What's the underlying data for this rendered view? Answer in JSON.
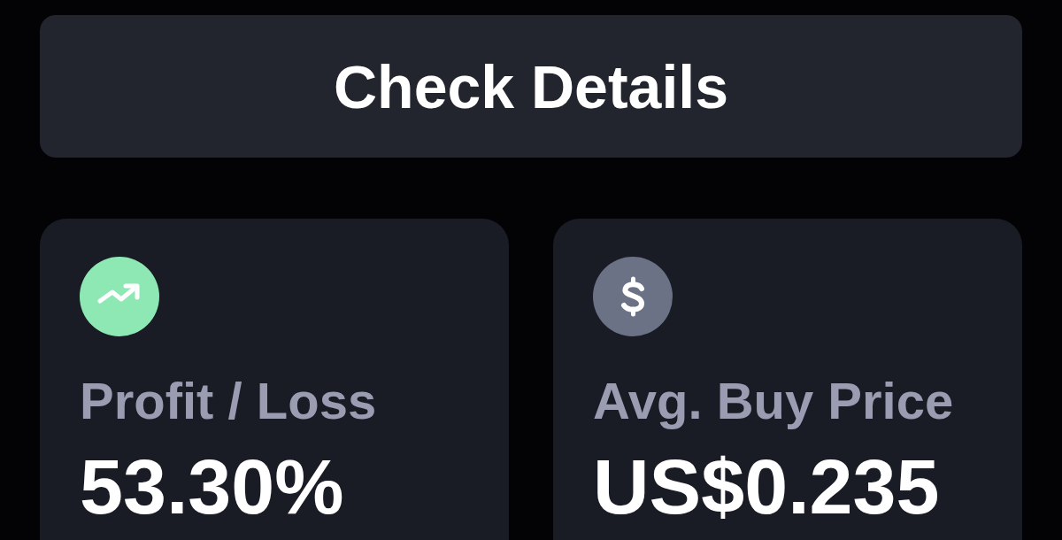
{
  "action_button": {
    "label": "Check Details"
  },
  "stat_cards": [
    {
      "kind": "trend",
      "color": "#8ee8b4",
      "label": "Profit / Loss",
      "value": "53.30%"
    },
    {
      "kind": "dollar",
      "color": "#6b7285",
      "label": "Avg. Buy Price",
      "value": "US$0.235"
    }
  ]
}
